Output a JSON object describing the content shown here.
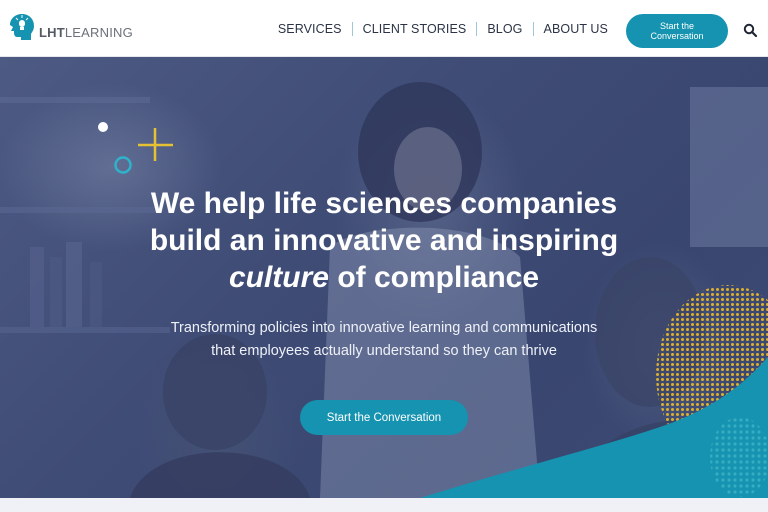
{
  "brand": {
    "logo_text_bold": "LHT",
    "logo_text_light": "LEARNING",
    "logo_icon": "head-lightbulb-icon",
    "accent_color": "#1593b0",
    "hero_overlay_color": "#3f4c76",
    "dot_pattern_color": "#e5b62a"
  },
  "nav": {
    "items": [
      {
        "label": "SERVICES"
      },
      {
        "label": "CLIENT STORIES"
      },
      {
        "label": "BLOG"
      },
      {
        "label": "ABOUT US"
      }
    ],
    "cta_label": "Start the Conversation",
    "search_icon": "search-icon"
  },
  "hero": {
    "title_line1": "We help life sciences companies",
    "title_line2": "build an innovative and inspiring",
    "title_line3_em": "culture",
    "title_line3_rest": " of compliance",
    "subtitle_line1": "Transforming policies into innovative learning and communications",
    "subtitle_line2": "that employees actually understand so they can thrive",
    "cta_label": "Start the Conversation"
  }
}
